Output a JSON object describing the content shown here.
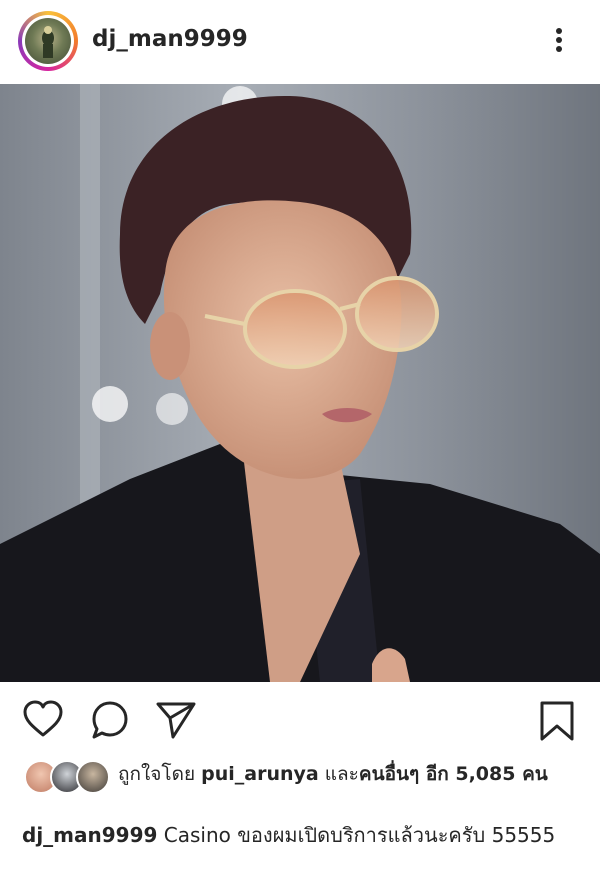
{
  "post": {
    "username": "dj_man9999",
    "more_icon": "more-vertical-icon",
    "photo_icon": "photo-image"
  },
  "actions": {
    "like_icon": "heart-icon",
    "comment_icon": "comment-icon",
    "share_icon": "send-icon",
    "save_icon": "bookmark-icon"
  },
  "likes": {
    "prefix": "ถูกใจโดย",
    "user": "pui_arunya",
    "and": "และ",
    "others": "คนอื่นๆ อีก 5,085 คน"
  },
  "caption": {
    "username": "dj_man9999",
    "text": "Casino ของผมเปิดบริการแล้วนะครับ 55555"
  }
}
